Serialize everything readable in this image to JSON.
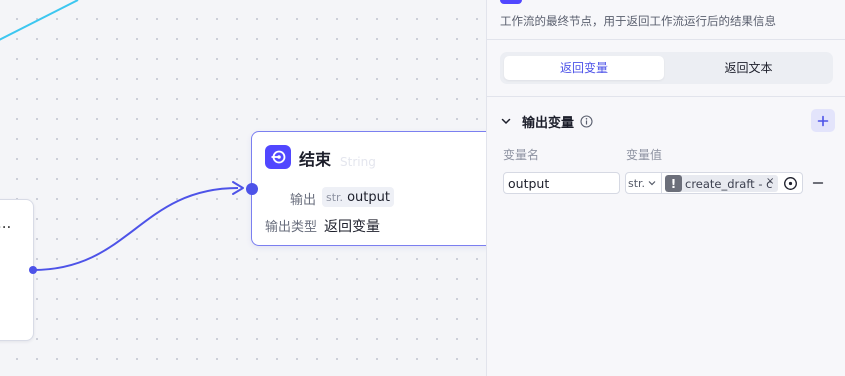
{
  "canvas": {
    "end_node": {
      "title": "结束",
      "ghost_text": "String",
      "output_label": "输出",
      "output_chip_type": "str.",
      "output_chip_name": "output",
      "output_type_label": "输出类型",
      "output_type_value": "返回变量"
    },
    "partial_node_ellipsis": "..."
  },
  "panel": {
    "description": "工作流的最终节点，用于返回工作流运行后的结果信息",
    "tabs": [
      {
        "label": "返回变量",
        "active": true
      },
      {
        "label": "返回文本",
        "active": false
      }
    ],
    "section_title": "输出变量",
    "col_name": "变量名",
    "col_value": "变量值",
    "row": {
      "name_value": "output",
      "type_value": "str.",
      "ref_text": "create_draft - c",
      "ref_close": "×"
    }
  },
  "colors": {
    "accent": "#4d53e8",
    "node_icon": "#5147ff",
    "edge_cyan": "#3cc7f0"
  },
  "icons": [
    "end-node-icon",
    "chevron-down-icon",
    "info-icon",
    "plus-icon",
    "warning-icon",
    "close-icon",
    "target-icon",
    "minus-icon"
  ]
}
